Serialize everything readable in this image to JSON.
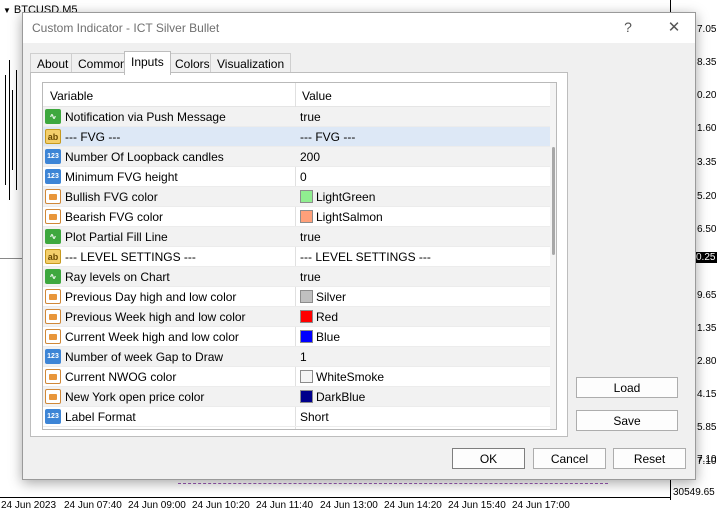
{
  "chart": {
    "symbol": "BTCUSD,M5",
    "price_labels": [
      "7.05",
      "8.35",
      "0.20",
      "1.60",
      "3.35",
      "5.20",
      "6.50",
      "0.25",
      "9.65",
      "1.35",
      "2.80",
      "4.15",
      "5.85",
      "7.10",
      "8.35",
      "30549.65"
    ],
    "time_labels": [
      "24 Jun 2023",
      "24 Jun 07:40",
      "24 Jun 09:00",
      "24 Jun 10:20",
      "24 Jun 11:40",
      "24 Jun 13:00",
      "24 Jun 14:20",
      "24 Jun 15:40",
      "24 Jun 17:00"
    ]
  },
  "dialog": {
    "title": "Custom Indicator - ICT Silver Bullet",
    "help": "?",
    "close": "✕",
    "tabs": [
      "About",
      "Common",
      "Inputs",
      "Colors",
      "Visualization"
    ],
    "active_tab": "Inputs",
    "columns": {
      "variable": "Variable",
      "value": "Value"
    },
    "rows": [
      {
        "type": "bool",
        "name": "Notification via Push Message",
        "value": "true"
      },
      {
        "type": "str",
        "name": "--- FVG ---",
        "value": "--- FVG ---"
      },
      {
        "type": "int",
        "name": "Number Of Loopback candles",
        "value": "200"
      },
      {
        "type": "int",
        "name": "Minimum FVG height",
        "value": "0"
      },
      {
        "type": "clr",
        "name": "Bullish FVG color",
        "value": "LightGreen",
        "swatch": "#90ee90"
      },
      {
        "type": "clr",
        "name": "Bearish FVG color",
        "value": "LightSalmon",
        "swatch": "#ffa07a"
      },
      {
        "type": "bool",
        "name": "Plot Partial Fill Line",
        "value": "true"
      },
      {
        "type": "str",
        "name": "--- LEVEL SETTINGS ---",
        "value": "--- LEVEL SETTINGS ---"
      },
      {
        "type": "bool",
        "name": "Ray levels on Chart",
        "value": "true"
      },
      {
        "type": "clr",
        "name": "Previous Day high and low color",
        "value": "Silver",
        "swatch": "#c0c0c0"
      },
      {
        "type": "clr",
        "name": "Previous Week high and low color",
        "value": "Red",
        "swatch": "#ff0000"
      },
      {
        "type": "clr",
        "name": "Current Week high and low color",
        "value": "Blue",
        "swatch": "#0000ff"
      },
      {
        "type": "int",
        "name": "Number of week Gap to Draw",
        "value": "1"
      },
      {
        "type": "clr",
        "name": "Current NWOG color",
        "value": "WhiteSmoke",
        "swatch": "#f5f5f5"
      },
      {
        "type": "clr",
        "name": "New York open price color",
        "value": "DarkBlue",
        "swatch": "#00008b"
      },
      {
        "type": "int",
        "name": "Label Format",
        "value": "Short"
      }
    ],
    "icons": {
      "bool": "∿",
      "str": "ab",
      "int": "123",
      "clr": ""
    },
    "buttons": {
      "load": "Load",
      "save": "Save",
      "ok": "OK",
      "cancel": "Cancel",
      "reset": "Reset"
    }
  }
}
